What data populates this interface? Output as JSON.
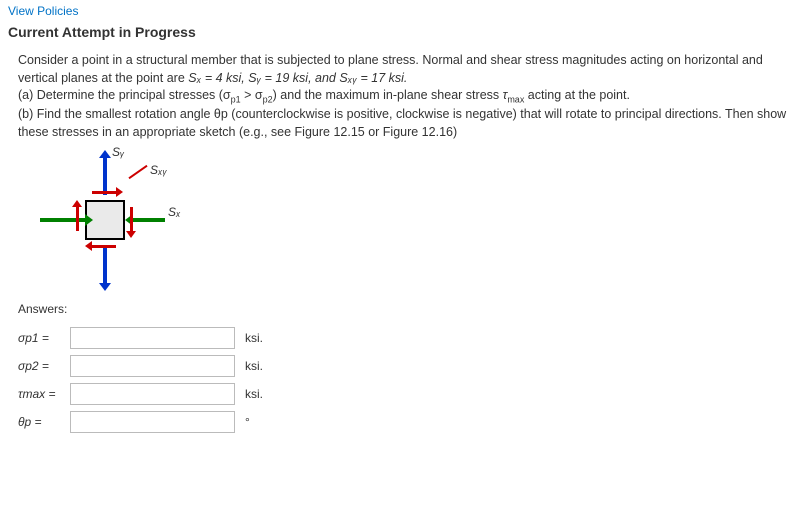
{
  "header": {
    "policies_link": "View Policies",
    "attempt_title": "Current Attempt in Progress"
  },
  "problem": {
    "intro": "Consider a point in a structural member that is subjected to plane stress. Normal and shear stress magnitudes acting on horizontal and vertical planes at the point are ",
    "values_text": "Sₓ = 4 ksi, Sᵧ = 19 ksi, and Sₓᵧ = 17 ksi.",
    "part_a": "(a) Determine the principal stresses (σp1 > σp2) and the maximum in-plane shear stress τmax acting at the point.",
    "part_b": "(b) Find the smallest rotation angle θp (counterclockwise is positive, clockwise is negative) that will rotate to principal directions. Then show these stresses in an appropriate sketch (e.g., see Figure 12.15 or Figure 12.16)"
  },
  "diagram": {
    "label_sy": "Sᵧ",
    "label_sxy": "Sₓᵧ",
    "label_sx": "Sₓ"
  },
  "answers": {
    "heading": "Answers:",
    "rows": [
      {
        "label": "σp1  =",
        "value": "",
        "unit": "ksi."
      },
      {
        "label": "σp2  =",
        "value": "",
        "unit": "ksi."
      },
      {
        "label": "τmax  =",
        "value": "",
        "unit": "ksi."
      },
      {
        "label": "θp  =",
        "value": "",
        "unit": "°"
      }
    ]
  }
}
